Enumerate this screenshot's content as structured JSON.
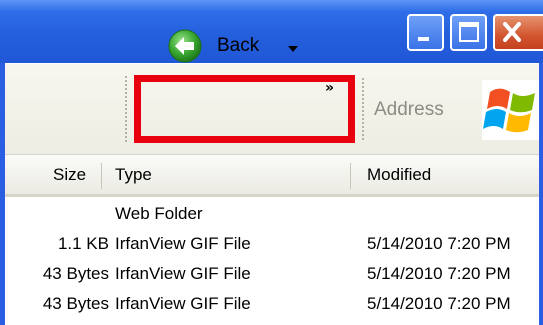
{
  "window": {
    "controls": {
      "minimize_icon": "minimize-icon",
      "maximize_icon": "maximize-icon",
      "close_icon": "close-icon"
    }
  },
  "toolbar": {
    "back_label": "Back",
    "more_glyph": "»",
    "address_label": "Address",
    "highlight_color": "#e8000e"
  },
  "columns": {
    "size": "Size",
    "type": "Type",
    "modified": "Modified"
  },
  "rows": [
    {
      "size": "",
      "type": "Web Folder",
      "modified": ""
    },
    {
      "size": "1.1 KB",
      "type": "IrfanView GIF File",
      "modified": "5/14/2010 7:20 PM"
    },
    {
      "size": "43 Bytes",
      "type": "IrfanView GIF File",
      "modified": "5/14/2010 7:20 PM"
    },
    {
      "size": "43 Bytes",
      "type": "IrfanView GIF File",
      "modified": "5/14/2010 7:20 PM"
    }
  ],
  "colors": {
    "title_bar": "#245fdc",
    "close_button": "#d2552f",
    "back_icon": "#3aa832"
  }
}
